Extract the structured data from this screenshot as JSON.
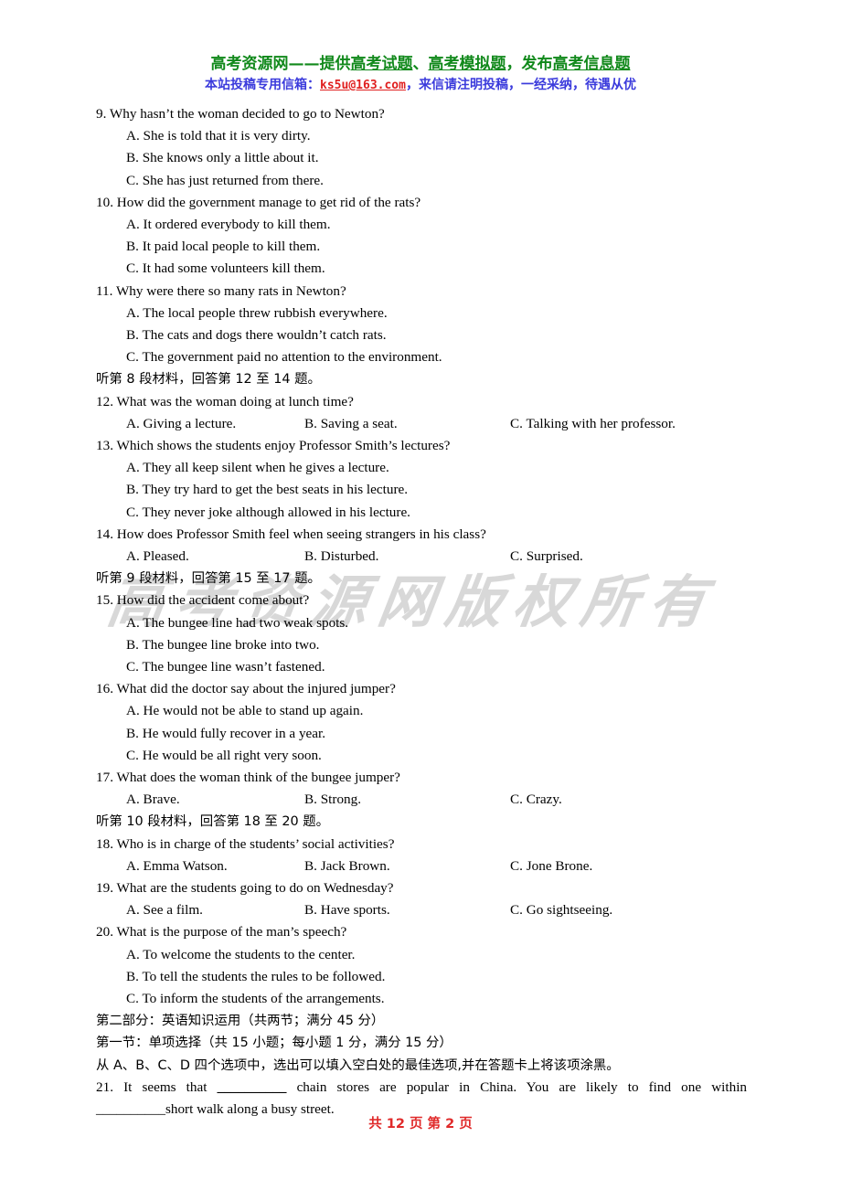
{
  "banner": {
    "line1_pre": "高考资源网——提供",
    "line1_link1": "高考试题",
    "line1_sep1": "、",
    "line1_link2": "高考模拟题",
    "line1_sep2": "，发布",
    "line1_link3": "高考信息题",
    "line2_pre": "本站投稿专用信箱：",
    "line2_mail": "ks5u@163.com",
    "line2_post": "，来信请注明投稿，一经采纳，待遇从优"
  },
  "watermark": "高考资源网版权所有",
  "footer": "共 12 页  第 2 页",
  "content": {
    "q9": "9. Why hasn’t the woman decided to go to Newton?",
    "q9a": "A. She is told that it is very dirty.",
    "q9b": "B. She knows only a little about it.",
    "q9c": "C. She has just returned from there.",
    "q10": "10. How did the government manage to get rid of the rats?",
    "q10a": "A. It ordered everybody to kill them.",
    "q10b": "B. It paid local people to kill them.",
    "q10c": "C. It had some volunteers kill them.",
    "q11": "11. Why were there so many rats in Newton?",
    "q11a": "A. The local people threw rubbish everywhere.",
    "q11b": "B. The cats and dogs there wouldn’t catch rats.",
    "q11c": "C. The government paid no attention to the environment.",
    "dir8": "听第 8 段材料，回答第 12 至 14 题。",
    "q12": "12. What was the woman doing at lunch time?",
    "q12a": "A. Giving a lecture.",
    "q12b": "B. Saving a seat.",
    "q12c": "C. Talking with her professor.",
    "q13": "13. Which shows the students enjoy Professor Smith’s lectures?",
    "q13a": "A. They all keep silent when he gives a lecture.",
    "q13b": "B. They try hard to get the best seats in his lecture.",
    "q13c": "C. They never joke although allowed in his lecture.",
    "q14": "14. How does Professor Smith feel when seeing strangers in his class?",
    "q14a": "A. Pleased.",
    "q14b": "B. Disturbed.",
    "q14c": "C. Surprised.",
    "dir9": "听第 9 段材料，回答第 15 至 17 题。",
    "q15": "15. How did the accident come about?",
    "q15a": "A. The bungee line had two weak spots.",
    "q15b": "B. The bungee line broke into two.",
    "q15c": "C. The bungee line wasn’t fastened.",
    "q16": "16. What did the doctor say about the injured jumper?",
    "q16a": "A. He would not be able to stand up again.",
    "q16b": "B. He would fully recover in a year.",
    "q16c": "C. He would be all right very soon.",
    "q17": "17. What does the woman think of the bungee jumper?",
    "q17a": "A. Brave.",
    "q17b": "B. Strong.",
    "q17c": "C. Crazy.",
    "dir10": "听第 10 段材料，回答第 18 至 20 题。",
    "q18": "18. Who is in charge of the students’ social activities?",
    "q18a": "A. Emma Watson.",
    "q18b": "B. Jack Brown.",
    "q18c": "C. Jone Brone.",
    "q19": "19. What are the students going to do on Wednesday?",
    "q19a": "A. See a film.",
    "q19b": "B. Have sports.",
    "q19c": "C. Go sightseeing.",
    "q20": "20. What is the purpose of the man’s speech?",
    "q20a": "A. To welcome the students to the center.",
    "q20b": "B. To tell the students the rules to be followed.",
    "q20c": "C. To inform the students of the arrangements.",
    "part2": "第二部分：英语知识运用（共两节；满分 45 分）",
    "sec1": "第一节：单项选择（共 15 小题；每小题 1 分，满分 15 分）",
    "sec1_inst": "从 A、B、C、D 四个选项中，选出可以填入空白处的最佳选项,并在答题卡上将该项涂黑。",
    "q21_p1": "21. It seems that",
    "q21_blank1": "__________",
    "q21_p2": "chain stores are popular in China. You are likely to find one within",
    "q21_blank2": "__________",
    "q21_p3": "short walk along a busy street."
  }
}
